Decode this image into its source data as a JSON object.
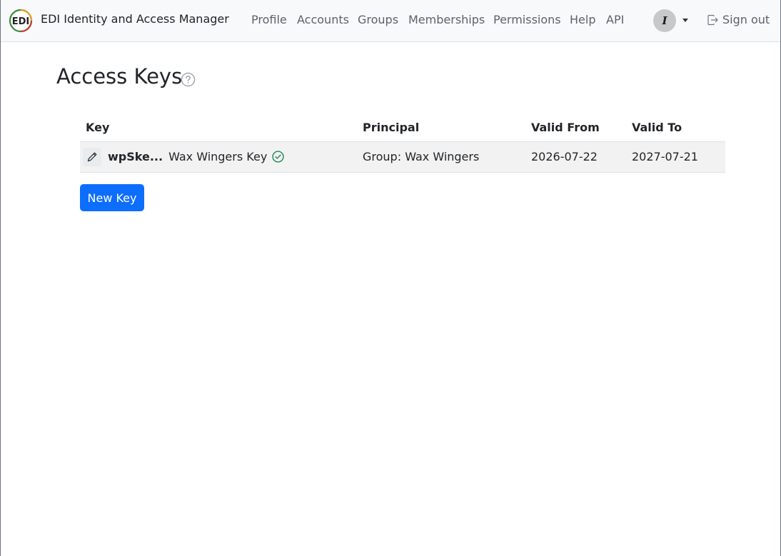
{
  "app": {
    "title": "EDI Identity and Access Manager"
  },
  "nav": {
    "items": [
      {
        "label": "Profile"
      },
      {
        "label": "Accounts"
      },
      {
        "label": "Groups"
      },
      {
        "label": "Memberships"
      },
      {
        "label": "Permissions"
      },
      {
        "label": "Help"
      },
      {
        "label": "API"
      }
    ],
    "avatar_initial": "I",
    "signout_label": "Sign out"
  },
  "page": {
    "title": "Access Keys",
    "help_icon": "question-circle-icon"
  },
  "table": {
    "headers": [
      "Key",
      "Principal",
      "Valid From",
      "Valid To"
    ],
    "rows": [
      {
        "key_id": "wpSke...",
        "key_name": "Wax Wingers Key",
        "status_icon": "check-circle-icon",
        "principal": "Group: Wax Wingers",
        "valid_from": "2026-07-22",
        "valid_to": "2027-07-21"
      }
    ]
  },
  "actions": {
    "new_key_label": "New Key"
  },
  "colors": {
    "primary": "#0d6efd",
    "success": "#198754",
    "navbar_bg": "#f8f9fa",
    "row_bg": "#f2f2f2"
  }
}
